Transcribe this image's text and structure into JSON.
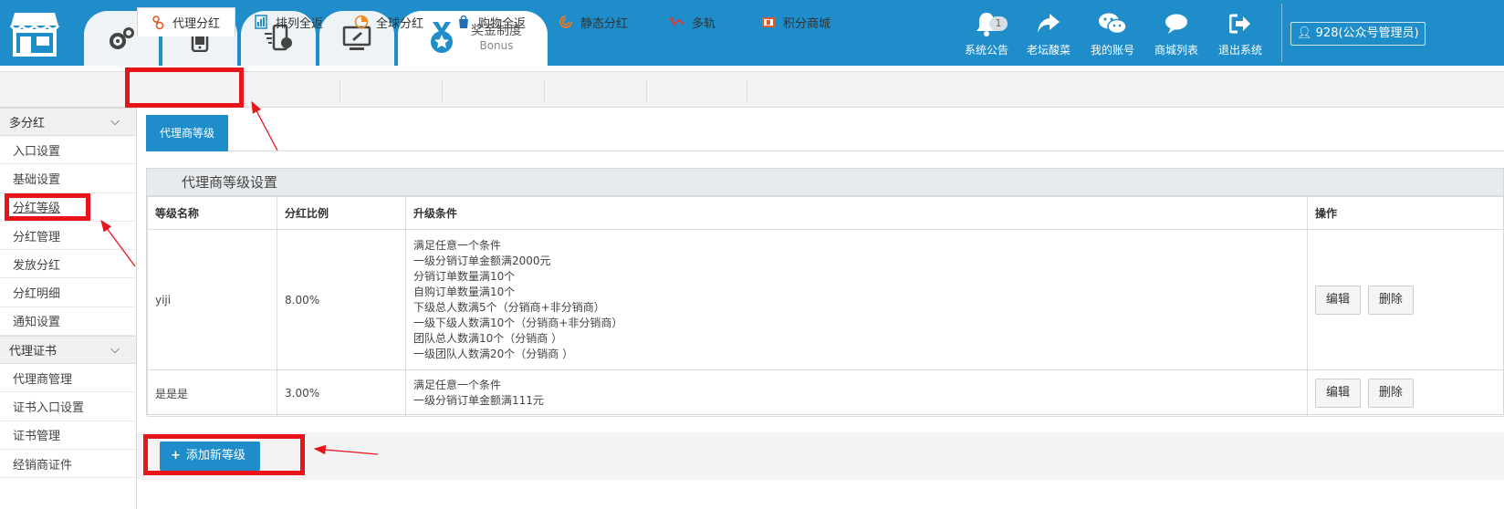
{
  "header": {
    "bonus_tab": {
      "title": "奖金制度",
      "subtitle": "Bonus"
    },
    "notice": {
      "label": "系统公告",
      "count": "1"
    },
    "forum": {
      "label": "老坛酸菜"
    },
    "account": {
      "label": "我的账号"
    },
    "shop_list": {
      "label": "商城列表"
    },
    "logout": {
      "label": "退出系统"
    },
    "user": {
      "label": "928(公众号管理员)"
    }
  },
  "subnav": {
    "tabs": [
      {
        "label": "代理分红",
        "color": "#e35b26"
      },
      {
        "label": "排列全返",
        "color": "#1f8dc9"
      },
      {
        "label": "全球分红",
        "color": "#f08a24"
      },
      {
        "label": "购物全返",
        "color": "#1f6fb5"
      },
      {
        "label": "静态分红",
        "color": "#e0792b"
      },
      {
        "label": "多轨",
        "color": "#d93a3a"
      },
      {
        "label": "积分商城",
        "color": "#e35b26"
      }
    ]
  },
  "sidebar": {
    "groups": [
      {
        "label": "多分红",
        "items": [
          "入口设置",
          "基础设置",
          "分红等级",
          "分红管理",
          "发放分红",
          "分红明细",
          "通知设置"
        ]
      },
      {
        "label": "代理证书",
        "items": [
          "代理商管理",
          "证书入口设置",
          "证书管理",
          "经销商证件"
        ]
      }
    ]
  },
  "main": {
    "tab": "代理商等级",
    "panel_title": "代理商等级设置",
    "columns": [
      "等级名称",
      "分红比例",
      "升级条件",
      "操作"
    ],
    "rows": [
      {
        "name": "yiji",
        "ratio": "8.00%",
        "conditions": [
          "满足任意一个条件",
          "一级分销订单金额满2000元",
          "分销订单数量满10个",
          "自购订单数量满10个",
          "下级总人数满5个（分销商+非分销商）",
          "一级下级人数满10个（分销商+非分销商）",
          "团队总人数满10个（分销商 ）",
          "一级团队人数满20个（分销商 ）"
        ],
        "edit": "编辑",
        "delete": "删除"
      },
      {
        "name": "是是是",
        "ratio": "3.00%",
        "conditions": [
          "满足任意一个条件",
          "一级分销订单金额满111元"
        ],
        "edit": "编辑",
        "delete": "删除"
      }
    ],
    "add_button": "添加新等级"
  },
  "colors": {
    "brand": "#1f8dc9",
    "highlight": "#e8141a"
  }
}
